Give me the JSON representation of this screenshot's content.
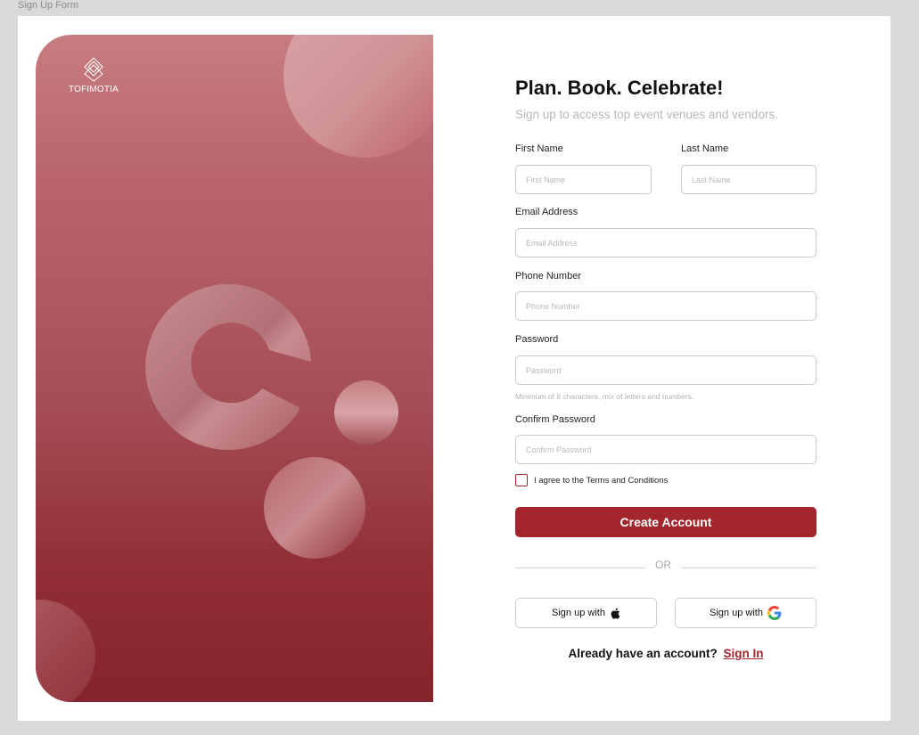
{
  "frame": {
    "label": "Sign Up Form"
  },
  "hero": {
    "brand": "TOFIMOTIA"
  },
  "form": {
    "title": "Plan. Book. Celebrate!",
    "subtitle": "Sign up to access top event venues and vendors.",
    "first_name": {
      "label": "First Name",
      "placeholder": "First Name",
      "value": ""
    },
    "last_name": {
      "label": "Last Name",
      "placeholder": "Last Name",
      "value": ""
    },
    "email": {
      "label": "Email Address",
      "placeholder": "Email Address",
      "value": ""
    },
    "phone": {
      "label": "Phone Number",
      "placeholder": "Phone Number",
      "value": ""
    },
    "password": {
      "label": "Password",
      "placeholder": "Password",
      "value": "",
      "hint": "Minimum of 8 characters, mix of letters and numbers."
    },
    "confirm_password": {
      "label": "Confirm Password",
      "placeholder": "Confirm Password",
      "value": ""
    },
    "terms": {
      "label": "I agree to the Terms and Conditions",
      "checked": false
    },
    "submit_label": "Create Account",
    "divider_text": "OR",
    "apple_button": {
      "label": "Sign up with",
      "icon": "apple-icon"
    },
    "google_button": {
      "label": "Sign up with",
      "icon": "google-icon"
    },
    "signin": {
      "prompt": "Already have an account?",
      "link": "Sign In"
    }
  },
  "colors": {
    "accent": "#a3262c",
    "page_background": "#d9d9d9",
    "panel_top": "#c77d80",
    "panel_bottom": "#85232c"
  }
}
